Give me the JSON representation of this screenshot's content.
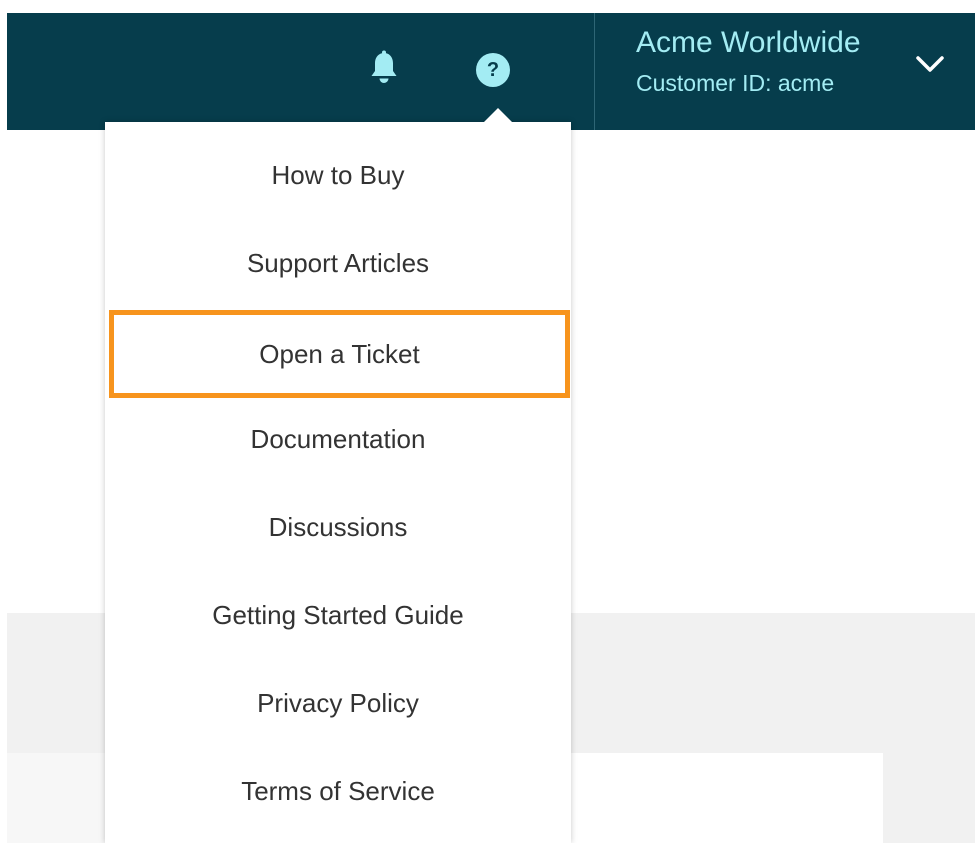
{
  "header": {
    "account_name": "Acme Worldwide",
    "customer_id": "Customer ID: acme",
    "notifications_icon": "bell-icon",
    "help_icon": "question-circle-icon",
    "help_glyph": "?",
    "expand_icon": "chevron-down-icon"
  },
  "help_menu": {
    "items": [
      {
        "label": "How to Buy"
      },
      {
        "label": "Support Articles"
      },
      {
        "label": "Open a Ticket",
        "highlighted": true
      },
      {
        "label": "Documentation"
      },
      {
        "label": "Discussions"
      },
      {
        "label": "Getting Started Guide"
      },
      {
        "label": "Privacy Policy"
      },
      {
        "label": "Terms of Service"
      }
    ]
  },
  "colors": {
    "header_background": "#063d4c",
    "header_accent": "#a3ecf3",
    "highlight_border": "#f7941d",
    "menu_text": "#333333"
  }
}
